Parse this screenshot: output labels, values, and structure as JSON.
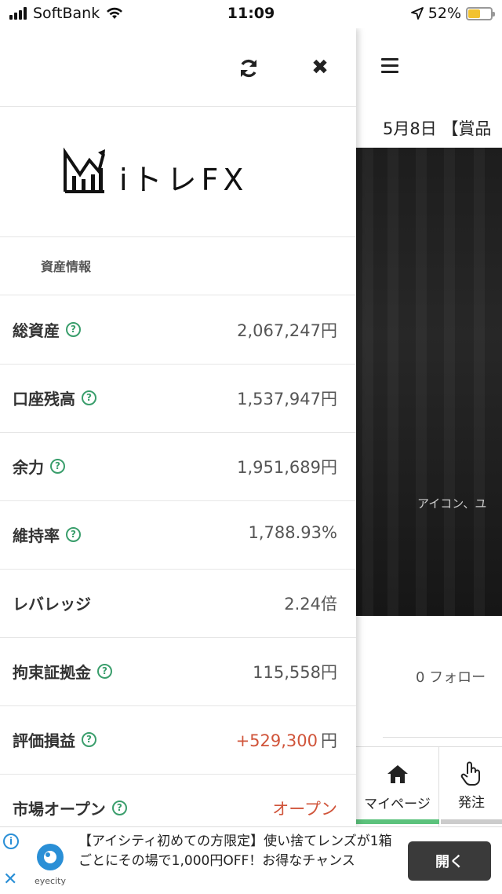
{
  "status_bar": {
    "carrier": "SoftBank",
    "time": "11:09",
    "battery": "52%",
    "battery_level": 0.52,
    "battery_color": "#f2c230"
  },
  "drawer": {
    "logo_text": "iトレFX",
    "section_title": "資産情報",
    "rows": [
      {
        "label": "総資産",
        "value": "2,067,247円",
        "help": true
      },
      {
        "label": "口座残高",
        "value": "1,537,947円",
        "help": true
      },
      {
        "label": "余力",
        "value": "1,951,689円",
        "help": true
      },
      {
        "label": "維持率",
        "value": "1,788.93%",
        "help": true
      },
      {
        "label": "レバレッジ",
        "value": "2.24倍",
        "help": false
      },
      {
        "label": "拘束証拠金",
        "value": "115,558円",
        "help": true
      },
      {
        "label": "評価損益",
        "value": "+529,300",
        "unit": "円",
        "help": true,
        "color": "#d0543a"
      },
      {
        "label": "市場オープン",
        "value": "オープン",
        "help": true,
        "color": "#d0543a"
      }
    ]
  },
  "background_page": {
    "date_line": "5月8日 【賞品",
    "hero_text": "アイコン、ユ",
    "follow_text": "0 フォロー",
    "tabs": [
      {
        "label": "マイページ",
        "icon": "home-icon",
        "active": true
      },
      {
        "label": "発注",
        "icon": "hand-pointer-icon",
        "active": false
      }
    ],
    "accent": "#5cc27c"
  },
  "ad": {
    "brand": "eyecity",
    "text": "【アイシティ初めての方限定】使い捨てレンズが1箱ごとにその場で1,000円OFF！お得なチャンス",
    "button": "開く"
  }
}
